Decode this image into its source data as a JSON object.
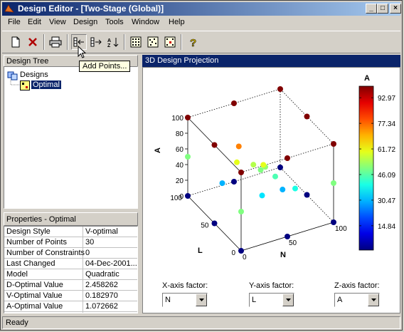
{
  "window": {
    "title": "Design Editor - [Two-Stage (Global)]",
    "controls": {
      "minimize": "_",
      "maximize": "□",
      "close": "×"
    }
  },
  "menu": [
    "File",
    "Edit",
    "View",
    "Design",
    "Tools",
    "Window",
    "Help"
  ],
  "toolbar": {
    "tooltip": "Add Points...",
    "icons": [
      "new-design-icon",
      "delete-icon",
      "print-icon",
      "add-points-icon",
      "delete-point-icon",
      "sort-icon",
      "doe-full-factorial-icon",
      "doe-space-filling-icon",
      "doe-optimal-icon",
      "help-icon"
    ]
  },
  "design_tree": {
    "header": "Design Tree",
    "root": "Designs",
    "child": "Optimal"
  },
  "properties": {
    "header": "Properties - Optimal",
    "rows": [
      {
        "key": "Design Style",
        "value": "V-optimal"
      },
      {
        "key": "Number of Points",
        "value": "30"
      },
      {
        "key": "Number of Constraints",
        "value": "0"
      },
      {
        "key": "Last Changed",
        "value": "04-Dec-2001..."
      },
      {
        "key": "Model",
        "value": "Quadratic"
      },
      {
        "key": "D-Optimal Value",
        "value": "2.458262"
      },
      {
        "key": "V-Optimal Value",
        "value": "0.182970"
      },
      {
        "key": "A-Optimal Value",
        "value": "1.072662"
      }
    ]
  },
  "projection": {
    "header": "3D Design Projection",
    "colorbar": {
      "label": "A",
      "ticks": [
        "92.97",
        "77.34",
        "61.72",
        "46.09",
        "30.47",
        "14.84"
      ]
    },
    "axes": {
      "z_label": "A",
      "z_ticks": [
        "100",
        "80",
        "60",
        "40",
        "20",
        "0"
      ],
      "l_label": "L",
      "l_ticks": [
        "100",
        "50",
        "0"
      ],
      "n_label": "N",
      "n_ticks": [
        "0",
        "50",
        "100"
      ]
    },
    "x_factor": {
      "label": "X-axis factor:",
      "value": "N"
    },
    "y_factor": {
      "label": "Y-axis factor:",
      "value": "L"
    },
    "z_factor": {
      "label": "Z-axis factor:",
      "value": "A"
    }
  },
  "chart_data": {
    "type": "scatter",
    "title": "",
    "xlabel": "N",
    "ylabel": "L",
    "zlabel": "A",
    "xlim": [
      0,
      100
    ],
    "ylim": [
      0,
      100
    ],
    "zlim": [
      0,
      100
    ],
    "colorscale": "jet",
    "points": [
      {
        "n": 0,
        "l": 0,
        "a": 0
      },
      {
        "n": 0,
        "l": 0,
        "a": 100
      },
      {
        "n": 0,
        "l": 100,
        "a": 0
      },
      {
        "n": 0,
        "l": 100,
        "a": 100
      },
      {
        "n": 100,
        "l": 0,
        "a": 0
      },
      {
        "n": 100,
        "l": 0,
        "a": 100
      },
      {
        "n": 100,
        "l": 100,
        "a": 0
      },
      {
        "n": 100,
        "l": 100,
        "a": 100
      },
      {
        "n": 50,
        "l": 0,
        "a": 0
      },
      {
        "n": 50,
        "l": 100,
        "a": 0
      },
      {
        "n": 0,
        "l": 50,
        "a": 0
      },
      {
        "n": 100,
        "l": 50,
        "a": 0
      },
      {
        "n": 0,
        "l": 50,
        "a": 100
      },
      {
        "n": 50,
        "l": 100,
        "a": 100
      },
      {
        "n": 50,
        "l": 0,
        "a": 100
      },
      {
        "n": 100,
        "l": 50,
        "a": 100
      },
      {
        "n": 0,
        "l": 100,
        "a": 50
      },
      {
        "n": 100,
        "l": 0,
        "a": 50
      },
      {
        "n": 0,
        "l": 0,
        "a": 50
      },
      {
        "n": 50,
        "l": 50,
        "a": 50
      },
      {
        "n": 45,
        "l": 55,
        "a": 55
      },
      {
        "n": 55,
        "l": 50,
        "a": 52
      },
      {
        "n": 50,
        "l": 45,
        "a": 60
      },
      {
        "n": 30,
        "l": 60,
        "a": 60
      },
      {
        "n": 60,
        "l": 40,
        "a": 45
      },
      {
        "n": 40,
        "l": 30,
        "a": 35
      },
      {
        "n": 20,
        "l": 70,
        "a": 30
      },
      {
        "n": 70,
        "l": 20,
        "a": 40
      },
      {
        "n": 35,
        "l": 65,
        "a": 75
      },
      {
        "n": 65,
        "l": 35,
        "a": 30
      }
    ]
  }
}
